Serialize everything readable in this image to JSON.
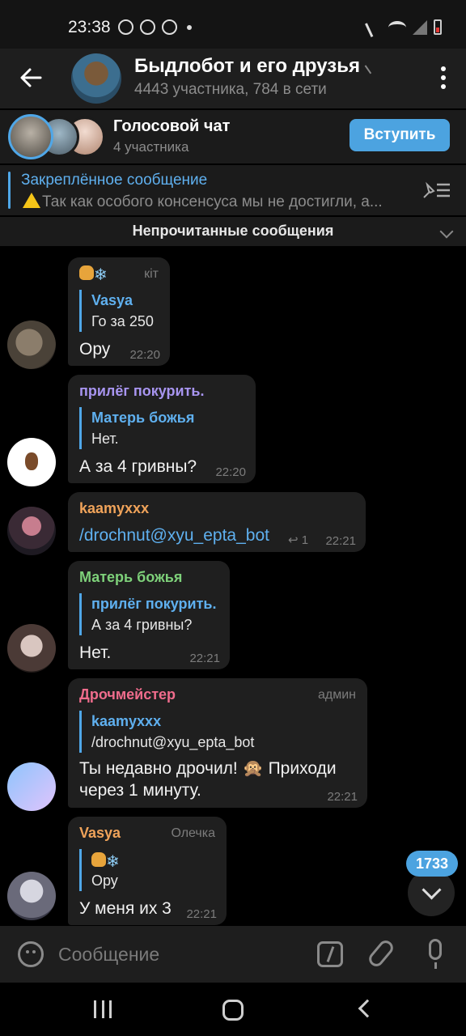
{
  "status": {
    "time": "23:38"
  },
  "header": {
    "title": "Быдлобот и его друзья",
    "subtitle": "4443 участника, 784 в сети"
  },
  "voice_chat": {
    "title": "Голосовой чат",
    "subtitle": "4 участника",
    "join_label": "Вступить"
  },
  "pinned": {
    "title": "Закреплённое сообщение",
    "text": "Так как особого консенсуса мы не достигли, а..."
  },
  "unread_label": "Непрочитанные сообщения",
  "messages": [
    {
      "badge": "кіт",
      "reply_name": "Vasya",
      "reply_text": "Го за 250",
      "text": "Ору",
      "time": "22:20"
    },
    {
      "sender": "прилёг покурить.",
      "reply_name": "Матерь божья",
      "reply_text": "Нет.",
      "text": "А за 4 гривны?",
      "time": "22:20"
    },
    {
      "sender": "kaamyxxx",
      "text": "/drochnut@xyu_epta_bot",
      "replies": "1",
      "time": "22:21"
    },
    {
      "sender": "Матерь божья",
      "reply_name": "прилёг покурить.",
      "reply_text": "А за 4 гривны?",
      "text": "Нет.",
      "time": "22:21"
    },
    {
      "sender": "Дрочмейстер",
      "badge": "админ",
      "reply_name": "kaamyxxx",
      "reply_text": "/drochnut@xyu_epta_bot",
      "text_line1": "Ты недавно дрочил! 🙊 Приходи",
      "text_line2": "через 1 минуту.",
      "time": "22:21"
    },
    {
      "sender": "Vasya",
      "badge": "Олечка",
      "reply_text": "Ору",
      "text": "У меня их 3",
      "time": "22:21"
    }
  ],
  "unread_count": "1733",
  "input": {
    "placeholder": "Сообщение"
  },
  "colors": {
    "accent": "#4ca3e0",
    "sender_purple": "#a895f0",
    "sender_orange": "#f0a35a",
    "sender_green": "#7ed17a",
    "sender_pink": "#ef6c8c"
  }
}
